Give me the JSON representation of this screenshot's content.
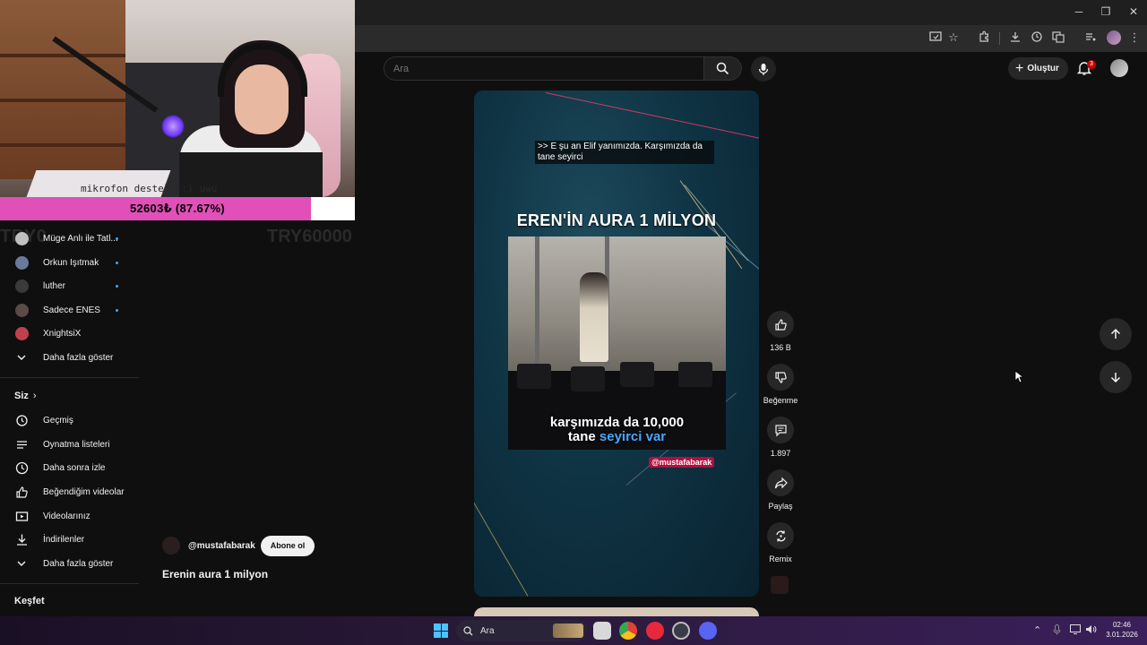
{
  "window": {
    "minimize": "─",
    "restore": "❐",
    "close": "✕"
  },
  "stream_overlay": {
    "webcam_caption": "mikrofon desteği :) uwu",
    "donation_text": "52603₺ (87.67%)",
    "donation_progress": 0.8767,
    "goal_label": "TRY0",
    "goal_target": "TRY60000",
    "bar_fill_color": "#e050b8"
  },
  "header": {
    "search_placeholder": "Ara",
    "create_label": "Oluştur",
    "notification_count": "3"
  },
  "sidebar": {
    "subscriptions": [
      {
        "label": "Müge Anlı ile Tatl...",
        "color": "#c0c0c0"
      },
      {
        "label": "Orkun Işıtmak",
        "color": "#6a7a9a"
      },
      {
        "label": "luther",
        "color": "#3a3a3a"
      },
      {
        "label": "Sadece ENES",
        "color": "#5a4a4a"
      },
      {
        "label": "XnightsiX",
        "color": "#c04050"
      }
    ],
    "show_more_1": "Daha fazla göster",
    "you_heading": "Siz",
    "you_items": [
      {
        "label": "Geçmiş",
        "icon": "history-icon"
      },
      {
        "label": "Oynatma listeleri",
        "icon": "playlists-icon"
      },
      {
        "label": "Daha sonra izle",
        "icon": "watch-later-icon"
      },
      {
        "label": "Beğendiğim videolar",
        "icon": "like-icon"
      },
      {
        "label": "Videolarınız",
        "icon": "your-videos-icon"
      },
      {
        "label": "İndirilenler",
        "icon": "downloads-icon"
      }
    ],
    "show_more_2": "Daha fazla göster",
    "explore_heading": "Keşfet"
  },
  "short": {
    "cc_caption": ">> E şu an Elif yanımızda. Karşımızda da tane seyirci",
    "overlay_title": "EREN'İN AURA 1 MİLYON",
    "clip_subtitle_line1": "karşımızda da 10,000",
    "clip_subtitle_line2_a": "tane",
    "clip_subtitle_line2_b": "seyirci var",
    "handle_tag": "@mustafabarak",
    "channel_handle": "@mustafabarak",
    "subscribe_label": "Abone ol",
    "title": "Erenin aura 1 milyon"
  },
  "actions": {
    "likes": "136 B",
    "dislike_label": "Beğenme",
    "comments": "1.897",
    "share_label": "Paylaş",
    "remix_label": "Remix"
  },
  "taskbar": {
    "search_label": "Ara",
    "time": "02:46",
    "date": "3.01.2026"
  }
}
